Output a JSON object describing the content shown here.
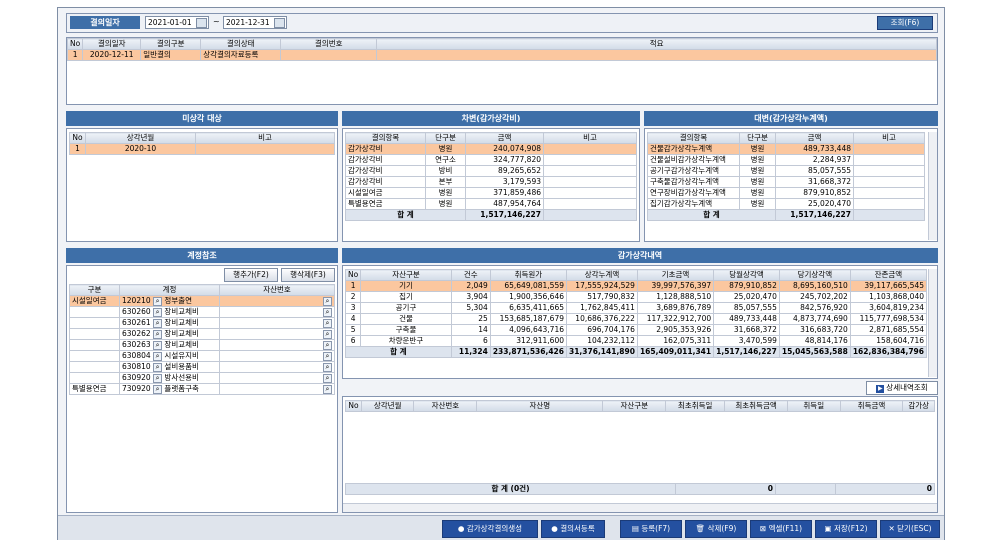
{
  "header": {
    "date_label": "결의일자",
    "date_from": "2021-01-01",
    "date_to": "2021-12-31",
    "search_btn": "조회(F6)"
  },
  "resolution": {
    "cols": [
      "No",
      "결의일자",
      "결의구분",
      "결의상태",
      "결의번호",
      "적요"
    ],
    "rows": [
      [
        "1",
        "2020-12-11",
        "일반결의",
        "상각결의자료등록",
        "",
        ""
      ]
    ]
  },
  "uncharged": {
    "title": "미상각 대상",
    "cols": [
      "No",
      "상각년월",
      "비고"
    ],
    "rows": [
      [
        "1",
        "2020-10",
        ""
      ]
    ]
  },
  "debit": {
    "title": "차변(감가상각비)",
    "cols": [
      "결의항목",
      "단구분",
      "금액",
      "비고"
    ],
    "rows": [
      [
        "감가상각비",
        "병원",
        "240,074,908",
        ""
      ],
      [
        "감가상각비",
        "연구소",
        "324,777,820",
        ""
      ],
      [
        "감가상각비",
        "방비",
        "89,265,652",
        ""
      ],
      [
        "감가상각비",
        "본부",
        "3,179,593",
        ""
      ],
      [
        "시설일여금",
        "병원",
        "371,859,486",
        ""
      ],
      [
        "특별용연금",
        "병원",
        "487,954,764",
        ""
      ]
    ],
    "total_label": "합  계",
    "total": "1,517,146,227"
  },
  "credit": {
    "title": "대변(감가상각누계액)",
    "cols": [
      "결의항목",
      "단구분",
      "금액",
      "비고"
    ],
    "rows": [
      [
        "건물감가상각누계액",
        "병원",
        "489,733,448",
        ""
      ],
      [
        "건물설비감가상각누계액",
        "병원",
        "2,284,937",
        ""
      ],
      [
        "공기구감가상각누계액",
        "병원",
        "85,057,555",
        ""
      ],
      [
        "구축물감가상각누계액",
        "병원",
        "31,668,372",
        ""
      ],
      [
        "연구장비감가상각누계액",
        "병원",
        "879,910,852",
        ""
      ],
      [
        "집기감가상각누계액",
        "병원",
        "25,020,470",
        ""
      ]
    ],
    "total_label": "합  계",
    "total": "1,517,146,227"
  },
  "account": {
    "title": "계정참조",
    "add_btn": "행추가(F2)",
    "del_btn": "행삭제(F3)",
    "cols": [
      "구분",
      "계정",
      "자산번호"
    ],
    "rows": [
      [
        "시설일여금",
        "120210",
        "정부출연",
        "sel"
      ],
      [
        "",
        "630260",
        "장비교체비",
        ""
      ],
      [
        "",
        "630261",
        "장비교체비",
        ""
      ],
      [
        "",
        "630262",
        "장비교체비",
        ""
      ],
      [
        "",
        "630263",
        "장비교체비",
        ""
      ],
      [
        "",
        "630804",
        "시설유지비",
        ""
      ],
      [
        "",
        "630810",
        "설비용품비",
        ""
      ],
      [
        "",
        "630920",
        "방사선용비",
        ""
      ],
      [
        "특별용연금",
        "730920",
        "플랫폼구축",
        ""
      ]
    ]
  },
  "dep": {
    "title": "감가상각내역",
    "cols": [
      "No",
      "자산구분",
      "건수",
      "취득원가",
      "상각누계액",
      "기초금액",
      "당월상각액",
      "당기상각액",
      "잔존금액"
    ],
    "rows": [
      [
        "1",
        "기기",
        "2,049",
        "65,649,081,559",
        "17,555,924,529",
        "39,997,576,397",
        "879,910,852",
        "8,695,160,510",
        "39,117,665,545"
      ],
      [
        "2",
        "집기",
        "3,904",
        "1,900,356,646",
        "517,790,832",
        "1,128,888,510",
        "25,020,470",
        "245,702,202",
        "1,103,868,040"
      ],
      [
        "3",
        "공기구",
        "5,304",
        "6,635,411,665",
        "1,762,845,411",
        "3,689,876,789",
        "85,057,555",
        "842,576,920",
        "3,604,819,234"
      ],
      [
        "4",
        "건물",
        "25",
        "153,685,187,679",
        "10,686,376,222",
        "117,322,912,700",
        "489,733,448",
        "4,873,774,690",
        "115,777,698,534"
      ],
      [
        "5",
        "구축물",
        "14",
        "4,096,643,716",
        "696,704,176",
        "2,905,353,926",
        "31,668,372",
        "316,683,720",
        "2,871,685,554"
      ],
      [
        "6",
        "차량운반구",
        "6",
        "312,911,600",
        "104,232,112",
        "162,075,311",
        "3,470,599",
        "48,814,176",
        "158,604,716"
      ]
    ],
    "total_label": "합  계",
    "total": [
      "11,324",
      "233,871,536,426",
      "31,376,141,890",
      "165,409,011,341",
      "1,517,146,227",
      "15,045,563,588",
      "162,836,384,796"
    ],
    "detail_btn": "상세내역조회"
  },
  "detail": {
    "cols": [
      "No",
      "상각년월",
      "자산번호",
      "자산명",
      "자산구분",
      "최초취득일",
      "최초취득금액",
      "취득일",
      "취득금액",
      "감가상"
    ],
    "total_label": "합  계 (0건)",
    "total_vals": [
      "0",
      "0"
    ]
  },
  "footer": {
    "b1": "감가상각결의생성",
    "b2": "결의서등록",
    "b3": "등록(F7)",
    "b4": "삭제(F9)",
    "b5": "엑셀(F11)",
    "b6": "저장(F12)",
    "b7": "닫기(ESC)"
  }
}
